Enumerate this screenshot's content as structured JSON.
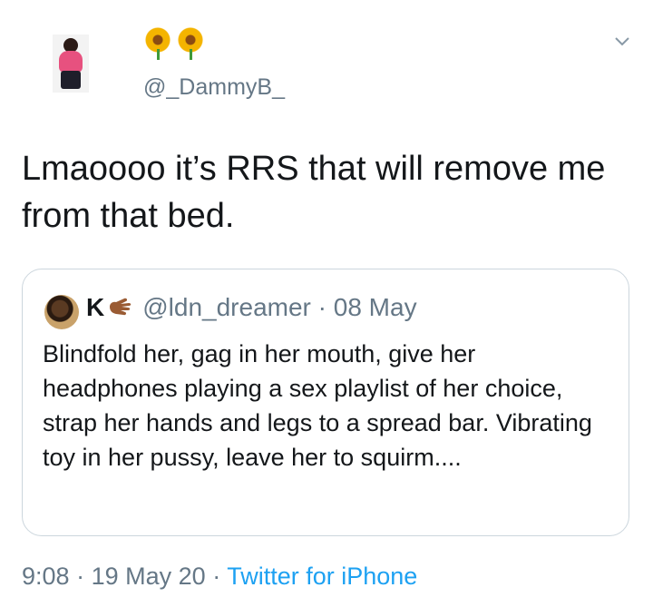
{
  "tweet": {
    "handle": "@_DammyB_",
    "display_name_emoji": [
      "sunflower-icon",
      "sunflower-icon"
    ],
    "text": "Lmaoooo it’s RRS that will remove me from that bed."
  },
  "quoted_tweet": {
    "name": "K",
    "name_emoji": "hand-icon",
    "handle": "@ldn_dreamer",
    "separator": "·",
    "date": "08 May",
    "text": "Blindfold her, gag in her mouth, give her headphones playing a sex playlist of her choice, strap her hands and legs to a spread bar. Vibrating toy in her pussy, leave her to squirm...."
  },
  "meta": {
    "time": "9:08",
    "sep1": "·",
    "date": "19 May 20",
    "sep2": "·",
    "source": "Twitter for iPhone"
  },
  "colors": {
    "text": "#14171a",
    "secondary": "#657786",
    "link": "#1da1f2",
    "border": "#ccd6dd"
  }
}
